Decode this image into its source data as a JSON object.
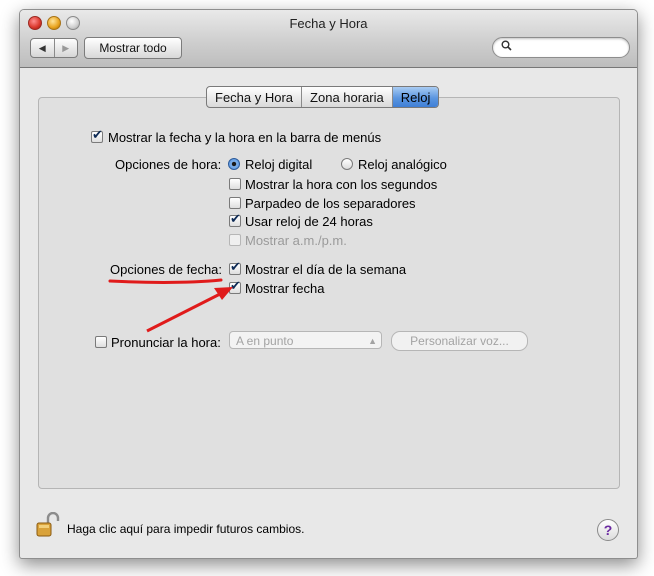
{
  "window": {
    "title": "Fecha y Hora"
  },
  "toolbar": {
    "back_icon": "◀",
    "forward_icon": "▶",
    "show_all_label": "Mostrar todo",
    "search_placeholder": "",
    "search_icon": "🔍"
  },
  "tabs": [
    {
      "label": "Fecha y Hora",
      "active": false
    },
    {
      "label": "Zona horaria",
      "active": false
    },
    {
      "label": "Reloj",
      "active": true
    }
  ],
  "clock": {
    "show_in_menubar": {
      "label": "Mostrar la fecha y la hora en la barra de menús",
      "checked": true
    },
    "time_options_label": "Opciones de hora:",
    "digital": {
      "label": "Reloj digital",
      "selected": true
    },
    "analog": {
      "label": "Reloj analógico",
      "selected": false
    },
    "seconds": {
      "label": "Mostrar la hora con los segundos",
      "checked": false
    },
    "blink": {
      "label": "Parpadeo de los separadores",
      "checked": false
    },
    "h24": {
      "label": "Usar reloj de 24 horas",
      "checked": true
    },
    "ampm": {
      "label": "Mostrar a.m./p.m.",
      "checked": false,
      "disabled": true
    },
    "date_options_label": "Opciones de fecha:",
    "weekday": {
      "label": "Mostrar el día de la semana",
      "checked": true
    },
    "date": {
      "label": "Mostrar fecha",
      "checked": true
    },
    "announce": {
      "label": "Pronunciar la hora:",
      "checked": false
    },
    "announce_interval": {
      "value": "A en punto",
      "disabled": true
    },
    "customize_voice": {
      "label": "Personalizar voz...",
      "disabled": true
    }
  },
  "footer": {
    "lock_text": "Haga clic aquí para impedir futuros cambios.",
    "help_label": "?"
  },
  "colors": {
    "annotation": "#e01b1b",
    "tab_active": "#5b96e0",
    "window_bg": "#e8e8e8"
  }
}
